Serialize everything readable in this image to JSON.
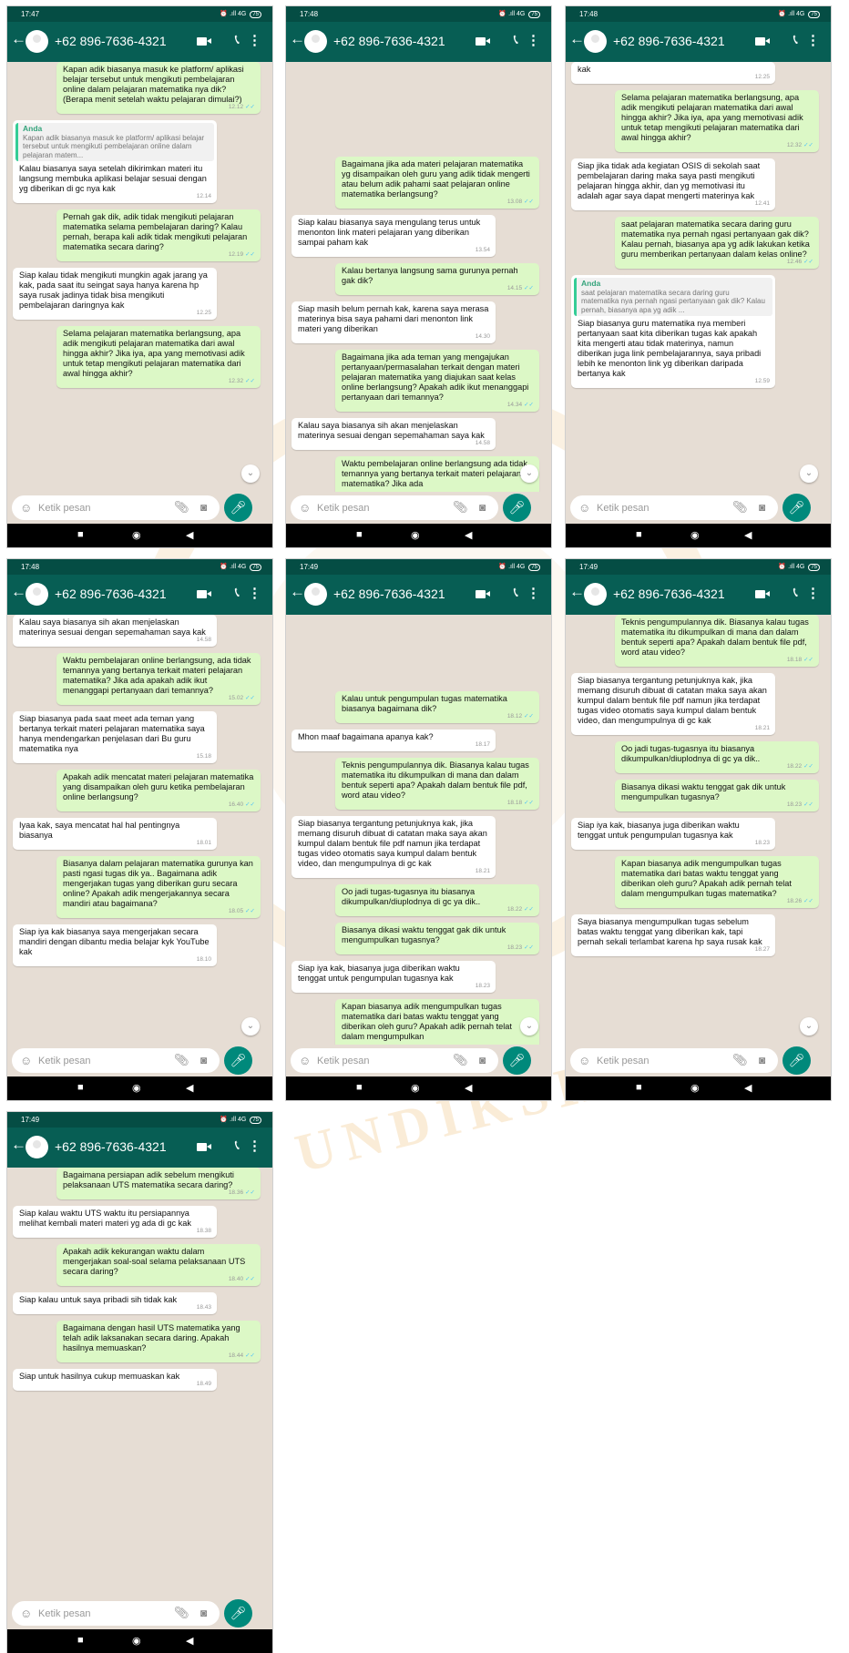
{
  "status_time": [
    "17:47",
    "17:48",
    "17:48",
    "17:48",
    "17:49",
    "17:49",
    "17:49"
  ],
  "contact_name": "+62 896-7636-4321",
  "network_indicator": "⏰ .ıll 4G ",
  "battery": "75",
  "input_placeholder": "Ketik pesan",
  "icons": {
    "back": "arrow-left-icon",
    "avatar": "default-avatar",
    "video": "video-camera-icon",
    "call": "phone-icon",
    "menu": "more-vertical-icon",
    "emoji": "emoji-icon",
    "attach": "paperclip-icon",
    "camera": "camera-icon",
    "mic": "microphone-icon",
    "scroll_down": "chevron-down-icon",
    "nav": [
      "stop-square-icon",
      "home-circle-icon",
      "back-triangle-icon"
    ]
  },
  "colors": {
    "header": "#075e54",
    "status_bar": "#054d44",
    "outgoing": "#dcf8c6",
    "incoming": "#ffffff",
    "chat_bg": "#e6ddd4",
    "fab": "#00897b",
    "read_tick": "#4fc3f7"
  },
  "watermark": [
    "UNDIKSHA"
  ],
  "screens": [
    {
      "messages": [
        {
          "dir": "out",
          "text": "Kapan adik biasanya masuk ke platform/ aplikasi belajar tersebut untuk mengikuti pembelajaran online dalam pelajaran matematika nya dik? (Berapa menit setelah waktu pelajaran dimulai?)",
          "time": "12.12",
          "tick": "✓✓"
        },
        {
          "dir": "in",
          "quote_name": "Anda",
          "quote_text": "Kapan adik biasanya masuk ke platform/ aplikasi belajar tersebut untuk mengikuti pembelajaran online dalam pelajaran matem...",
          "text": "Kalau biasanya saya setelah dikirimkan materi itu langsung membuka aplikasi belajar sesuai dengan yg diberikan di gc nya kak",
          "time": "12.14"
        },
        {
          "dir": "out",
          "text": "Pernah gak dik, adik tidak mengikuti pelajaran matematika selama pembelajaran daring? Kalau pernah, berapa kali adik tidak mengikuti pelajaran matematika secara daring?",
          "time": "12.19",
          "tick": "✓✓"
        },
        {
          "dir": "in",
          "text": "Siap kalau tidak mengikuti mungkin agak jarang ya kak, pada saat itu seingat saya hanya karena hp saya rusak jadinya tidak bisa mengikuti pembelajaran daringnya kak",
          "time": "12.25"
        },
        {
          "dir": "out",
          "text": "Selama pelajaran matematika berlangsung, apa adik mengikuti pelajaran matematika dari awal hingga akhir? Jika iya, apa yang memotivasi adik untuk tetap mengikuti pelajaran matematika dari awal hingga akhir?",
          "time": "12.32",
          "tick": "✓✓"
        }
      ]
    },
    {
      "messages": [
        {
          "dir": "out",
          "text": "Bagaimana jika ada materi pelajaran matematika yg disampaikan oleh guru yang adik tidak mengerti atau belum adik pahami saat pelajaran online matematika berlangsung?",
          "time": "13.08",
          "tick": "✓✓"
        },
        {
          "dir": "in",
          "text": "Siap kalau biasanya saya mengulang terus untuk menonton link materi pelajaran yang diberikan sampai paham kak",
          "time": "13.54"
        },
        {
          "dir": "out",
          "text": "Kalau bertanya langsung sama gurunya pernah gak dik?",
          "time": "14.15",
          "tick": "✓✓"
        },
        {
          "dir": "in",
          "text": "Siap masih belum pernah kak, karena saya merasa materinya bisa saya pahami dari menonton link materi yang diberikan",
          "time": "14.30"
        },
        {
          "dir": "out",
          "text": "Bagaimana jika ada teman yang mengajukan pertanyaan/permasalahan terkait dengan materi pelajaran matematika yang diajukan saat kelas online berlangsung? Apakah adik ikut menanggapi pertanyaan dari temannya?",
          "time": "14.34",
          "tick": "✓✓"
        },
        {
          "dir": "in",
          "text": "Kalau saya biasanya sih akan menjelaskan materinya sesuai dengan sepemahaman saya kak",
          "time": "14.58"
        },
        {
          "dir": "out",
          "text": "Waktu pembelajaran online berlangsung ada tidak temannya yang bertanya terkait materi pelajaran matematika? Jika ada",
          "time": "",
          "tick": ""
        }
      ]
    },
    {
      "messages": [
        {
          "dir": "in",
          "text": "kak",
          "time": "12.25"
        },
        {
          "dir": "out",
          "text": "Selama pelajaran matematika berlangsung, apa adik mengikuti pelajaran matematika dari awal hingga akhir? Jika iya, apa yang memotivasi adik untuk tetap mengikuti pelajaran matematika dari awal hingga akhir?",
          "time": "12.32",
          "tick": "✓✓"
        },
        {
          "dir": "in",
          "text": "Siap jika tidak ada kegiatan OSIS di sekolah saat pembelajaran daring maka saya pasti mengikuti pelajaran hingga akhir, dan yg memotivasi itu adalah agar saya dapat mengerti materinya kak",
          "time": "12.41"
        },
        {
          "dir": "out",
          "text": "saat pelajaran matematika secara daring guru matematika nya pernah ngasi pertanyaan gak dik? Kalau pernah, biasanya apa yg adik lakukan ketika guru memberikan pertanyaan dalam kelas online?",
          "time": "12.46",
          "tick": "✓✓"
        },
        {
          "dir": "in",
          "quote_name": "Anda",
          "quote_text": "saat pelajaran matematika secara daring guru matematika nya pernah ngasi pertanyaan gak dik? Kalau pernah, biasanya apa yg adik ...",
          "text": "Siap biasanya guru matematika nya memberi pertanyaan saat kita diberikan tugas kak apakah kita mengerti atau tidak materinya, namun diberikan juga link pembelajarannya, saya pribadi lebih ke menonton link yg diberikan daripada bertanya kak",
          "time": "12.59"
        }
      ]
    },
    {
      "messages": [
        {
          "dir": "in",
          "text": "Kalau saya biasanya sih akan menjelaskan materinya sesuai dengan sepemahaman saya kak",
          "time": "14.58"
        },
        {
          "dir": "out",
          "text": "Waktu pembelajaran online berlangsung, ada tidak temannya yang bertanya terkait materi pelajaran matematika? Jika ada apakah adik ikut menanggapi pertanyaan dari temannya?",
          "time": "15.02",
          "tick": "✓✓"
        },
        {
          "dir": "in",
          "text": "Siap biasanya pada saat meet ada teman yang bertanya terkait materi pelajaran matematika saya hanya mendengarkan penjelasan dari Bu guru matematika nya",
          "time": "15.18"
        },
        {
          "dir": "out",
          "text": "Apakah adik mencatat materi pelajaran matematika yang disampaikan oleh guru ketika pembelajaran online berlangsung?",
          "time": "16.40",
          "tick": "✓✓"
        },
        {
          "dir": "in",
          "text": "Iyaa kak, saya mencatat hal hal pentingnya biasanya",
          "time": "18.01"
        },
        {
          "dir": "out",
          "text": "Biasanya dalam pelajaran matematika gurunya kan pasti ngasi tugas dik ya.. Bagaimana adik mengerjakan tugas yang diberikan guru secara online? Apakah adik mengerjakannya secara mandiri atau bagaimana?",
          "time": "18.05",
          "tick": "✓✓"
        },
        {
          "dir": "in",
          "text": "Siap iya kak biasanya saya mengerjakan secara mandiri dengan dibantu media belajar kyk YouTube kak",
          "time": "18.10"
        }
      ]
    },
    {
      "messages": [
        {
          "dir": "out",
          "text": "Kalau untuk pengumpulan tugas matematika biasanya bagaimana dik?",
          "time": "18.12",
          "tick": "✓✓"
        },
        {
          "dir": "in",
          "text": "Mhon maaf bagaimana apanya kak?",
          "time": "18.17"
        },
        {
          "dir": "out",
          "text": "Teknis pengumpulannya dik. Biasanya kalau tugas matematika itu dikumpulkan di mana dan dalam bentuk seperti apa? Apakah dalam bentuk file pdf, word atau video?",
          "time": "18.18",
          "tick": "✓✓"
        },
        {
          "dir": "in",
          "text": "Siap biasanya tergantung petunjuknya kak, jika memang disuruh dibuat di catatan maka saya akan kumpul dalam bentuk file pdf namun jika terdapat tugas video otomatis saya kumpul dalam bentuk video, dan mengumpulnya di gc kak",
          "time": "18.21"
        },
        {
          "dir": "out",
          "text": "Oo jadi tugas-tugasnya itu biasanya dikumpulkan/diuplodnya di gc ya dik..",
          "time": "18.22",
          "tick": "✓✓"
        },
        {
          "dir": "out",
          "text": "Biasanya dikasi waktu tenggat gak dik untuk mengumpulkan tugasnya?",
          "time": "18.23",
          "tick": "✓✓"
        },
        {
          "dir": "in",
          "text": "Siap iya kak, biasanya juga diberikan waktu tenggat untuk pengumpulan tugasnya kak",
          "time": "18.23"
        },
        {
          "dir": "out",
          "text": "Kapan biasanya adik mengumpulkan tugas matematika dari batas waktu tenggat yang diberikan oleh guru? Apakah adik pernah telat dalam mengumpulkan",
          "time": "",
          "tick": ""
        }
      ]
    },
    {
      "messages": [
        {
          "dir": "out",
          "text": "Teknis pengumpulannya dik. Biasanya kalau tugas matematika itu dikumpulkan di mana dan dalam bentuk seperti apa? Apakah dalam bentuk file pdf, word atau video?",
          "time": "18.18",
          "tick": "✓✓"
        },
        {
          "dir": "in",
          "text": "Siap biasanya tergantung petunjuknya kak, jika memang disuruh dibuat di catatan maka saya akan kumpul dalam bentuk file pdf namun jika terdapat tugas video otomatis saya kumpul dalam bentuk video, dan mengumpulnya di gc kak",
          "time": "18.21"
        },
        {
          "dir": "out",
          "text": "Oo jadi tugas-tugasnya itu biasanya dikumpulkan/diuplodnya di gc ya dik..",
          "time": "18.22",
          "tick": "✓✓"
        },
        {
          "dir": "out",
          "text": "Biasanya dikasi waktu tenggat gak dik untuk mengumpulkan tugasnya?",
          "time": "18.23",
          "tick": "✓✓"
        },
        {
          "dir": "in",
          "text": "Siap iya kak, biasanya juga diberikan waktu tenggat untuk pengumpulan tugasnya kak",
          "time": "18.23"
        },
        {
          "dir": "out",
          "text": "Kapan biasanya adik mengumpulkan tugas matematika dari batas waktu tenggat yang diberikan oleh guru? Apakah adik pernah telat dalam mengumpulkan tugas matematika?",
          "time": "18.26",
          "tick": "✓✓"
        },
        {
          "dir": "in",
          "text": "Saya biasanya mengumpulkan tugas sebelum batas waktu tenggat yang diberikan kak, tapi pernah sekali terlambat karena hp saya rusak kak",
          "time": "18.27"
        }
      ]
    },
    {
      "messages": [
        {
          "dir": "out",
          "text": "Bagaimana persiapan adik sebelum mengikuti pelaksanaan UTS matematika secara daring?",
          "time": "18.36",
          "tick": "✓✓"
        },
        {
          "dir": "in",
          "text": "Siap kalau waktu UTS waktu itu persiapannya melihat kembali materi materi yg ada di gc kak",
          "time": "18.38"
        },
        {
          "dir": "out",
          "text": "Apakah adik kekurangan waktu dalam mengerjakan soal-soal selama pelaksanaan UTS secara daring?",
          "time": "18.40",
          "tick": "✓✓"
        },
        {
          "dir": "in",
          "text": "Siap kalau untuk saya pribadi sih tidak kak",
          "time": "18.43"
        },
        {
          "dir": "out",
          "text": "Bagaimana dengan hasil UTS matematika yang telah adik laksanakan secara daring. Apakah hasilnya memuaskan?",
          "time": "18.44",
          "tick": "✓✓"
        },
        {
          "dir": "in",
          "text": "Siap untuk hasilnya cukup memuaskan kak",
          "time": "18.49"
        }
      ]
    }
  ]
}
